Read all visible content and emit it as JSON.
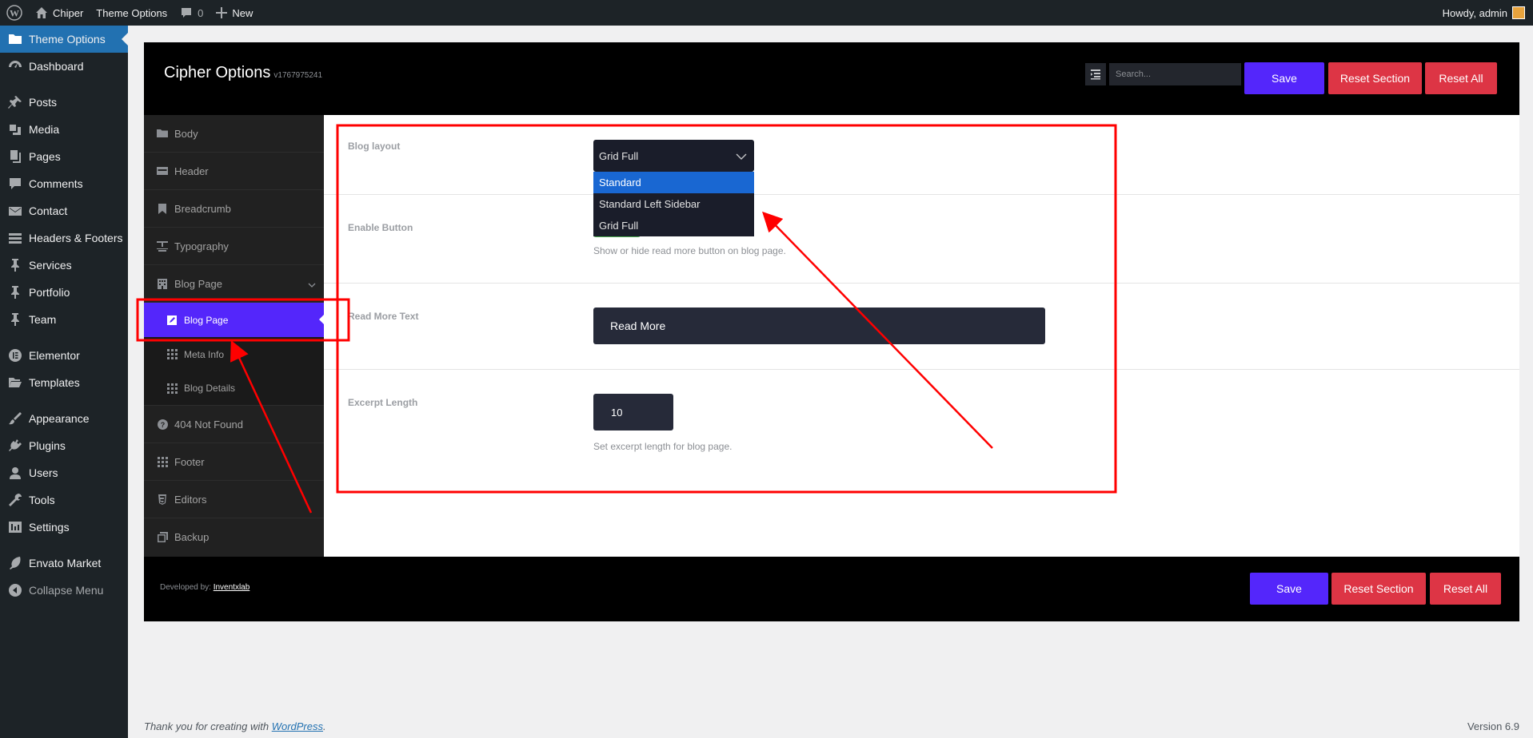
{
  "adminbar": {
    "site_name": "Chiper",
    "theme_options": "Theme Options",
    "comments_count": "0",
    "new_label": "New",
    "howdy": "Howdy, admin"
  },
  "adminmenu": {
    "items": [
      {
        "label": "Theme Options",
        "icon": "folder-icon"
      },
      {
        "label": "Dashboard",
        "icon": "dashboard-icon"
      },
      {
        "label": "Posts",
        "icon": "pin-icon"
      },
      {
        "label": "Media",
        "icon": "media-icon"
      },
      {
        "label": "Pages",
        "icon": "pages-icon"
      },
      {
        "label": "Comments",
        "icon": "comment-icon"
      },
      {
        "label": "Contact",
        "icon": "mail-icon"
      },
      {
        "label": "Headers & Footers",
        "icon": "list-icon"
      },
      {
        "label": "Services",
        "icon": "pin-icon"
      },
      {
        "label": "Portfolio",
        "icon": "pin-icon"
      },
      {
        "label": "Team",
        "icon": "pin-icon"
      },
      {
        "label": "Elementor",
        "icon": "elementor-icon"
      },
      {
        "label": "Templates",
        "icon": "folder-open-icon"
      },
      {
        "label": "Appearance",
        "icon": "brush-icon"
      },
      {
        "label": "Plugins",
        "icon": "plugin-icon"
      },
      {
        "label": "Users",
        "icon": "user-icon"
      },
      {
        "label": "Tools",
        "icon": "wrench-icon"
      },
      {
        "label": "Settings",
        "icon": "settings-icon"
      },
      {
        "label": "Envato Market",
        "icon": "leaf-icon"
      },
      {
        "label": "Collapse Menu",
        "icon": "collapse-icon"
      }
    ]
  },
  "panel": {
    "title": "Cipher Options",
    "version": "v1767975241",
    "search_placeholder": "Search...",
    "save": "Save",
    "reset_section": "Reset Section",
    "reset_all": "Reset All",
    "developed_by": "Developed by:",
    "developer": "Inventxlab"
  },
  "sidebar": {
    "items": [
      {
        "label": "Body"
      },
      {
        "label": "Header"
      },
      {
        "label": "Breadcrumb"
      },
      {
        "label": "Typography"
      },
      {
        "label": "Blog Page"
      },
      {
        "label": "404 Not Found"
      },
      {
        "label": "Footer"
      },
      {
        "label": "Editors"
      },
      {
        "label": "Backup"
      }
    ],
    "sub": [
      {
        "label": "Blog Page"
      },
      {
        "label": "Meta Info"
      },
      {
        "label": "Blog Details"
      }
    ]
  },
  "fields": {
    "blog_layout": {
      "label": "Blog layout",
      "value": "Grid Full",
      "options": [
        "Standard",
        "Standard Left Sidebar",
        "Grid Full"
      ]
    },
    "enable_button": {
      "label": "Enable Button",
      "desc": "Show or hide read more button on blog page."
    },
    "read_more": {
      "label": "Read More Text",
      "value": "Read More"
    },
    "excerpt": {
      "label": "Excerpt Length",
      "value": "10",
      "desc": "Set excerpt length for blog page."
    }
  },
  "footer": {
    "thanks": "Thank you for creating with",
    "wp_link": "WordPress",
    "version": "Version 6.9"
  },
  "colors": {
    "accent": "#5426fb",
    "reset": "#dd3545",
    "annotation": "#ff0000"
  }
}
